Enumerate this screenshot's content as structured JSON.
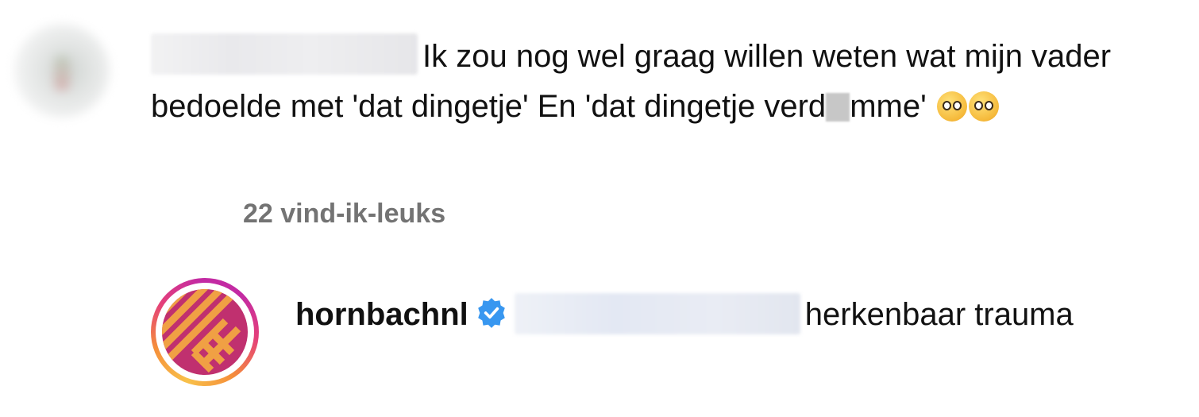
{
  "comment": {
    "text_part1": "Ik zou nog wel graag willen weten wat mijn vader bedoelde met 'dat dingetje' En 'dat dingetje verd",
    "text_part2": "mme'",
    "likes": "22 vind-ik-leuks"
  },
  "reply": {
    "username": "hornbachnl",
    "text": "herkenbaar trauma"
  },
  "icons": {
    "verified_badge": "verified-badge-icon",
    "emoji": "pleading-face-emoji"
  },
  "colors": {
    "likes_text": "#737373",
    "verified_blue": "#3897f0",
    "brand_magenta": "#c0306f",
    "brand_orange": "#f0a044"
  }
}
